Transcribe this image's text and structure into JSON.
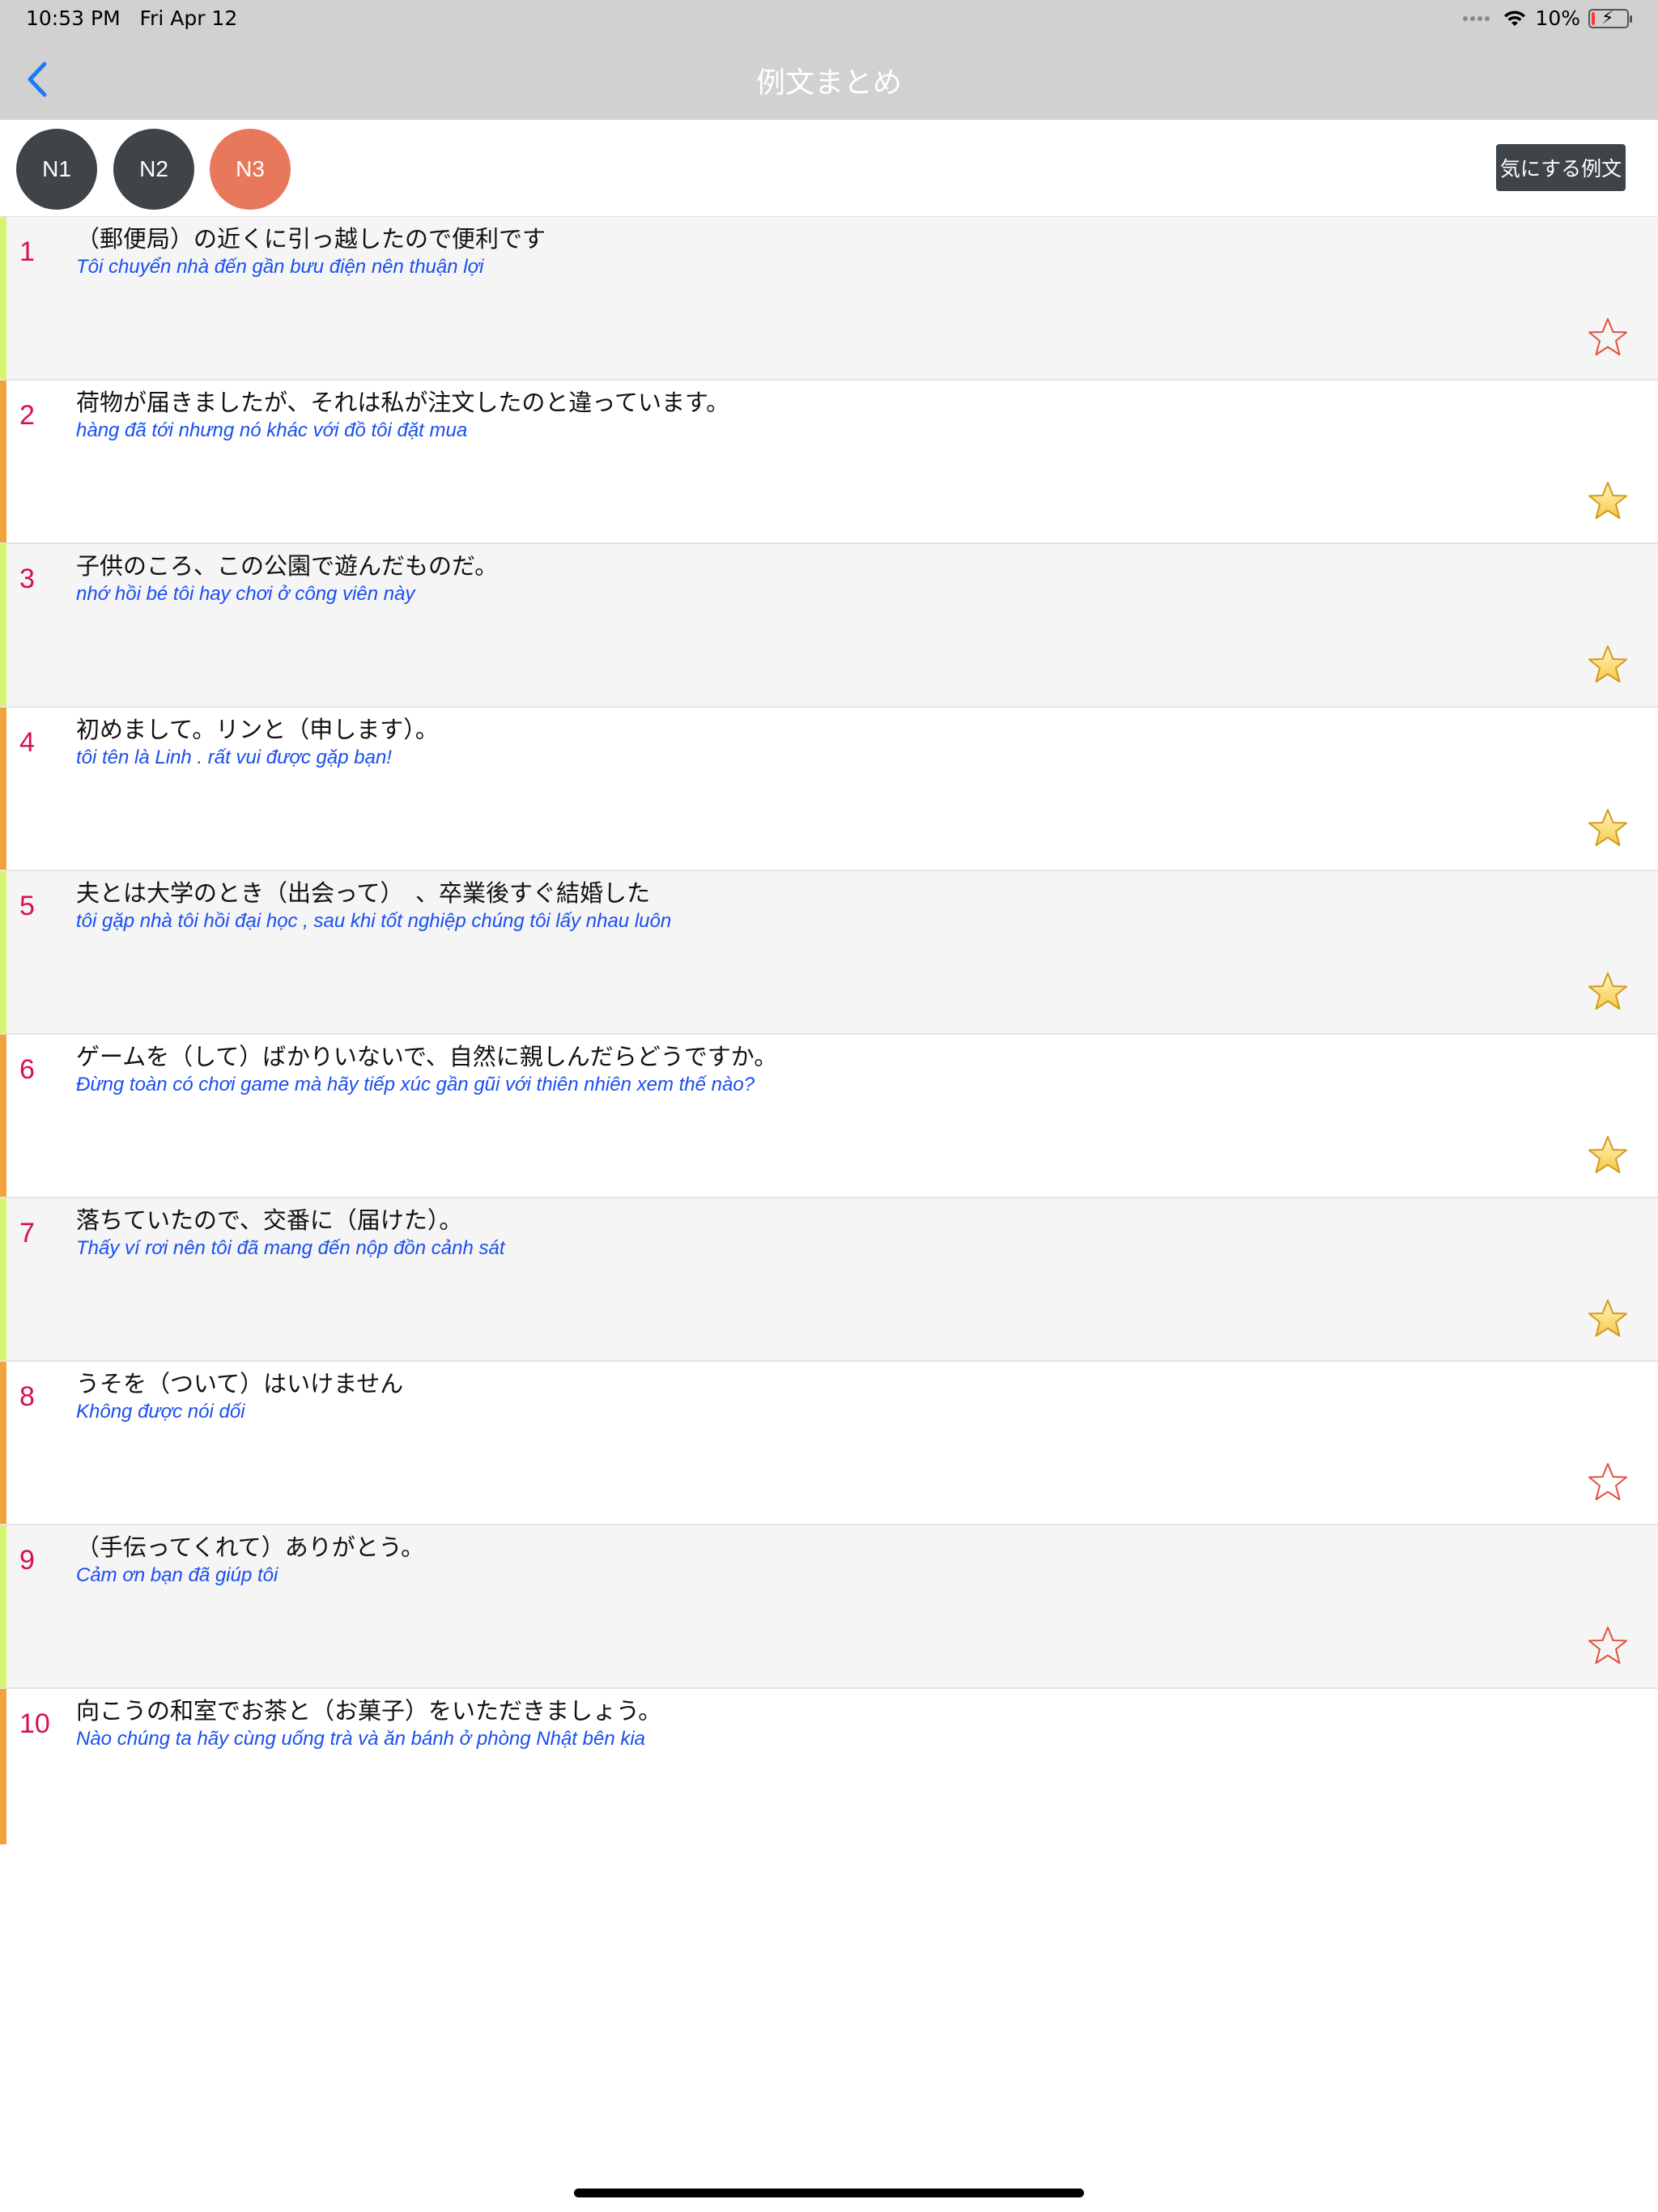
{
  "status_bar": {
    "time": "10:53 PM",
    "date": "Fri Apr 12",
    "battery": "10%",
    "battery_level": 0.1,
    "battery_color": "#ff3b30"
  },
  "nav": {
    "title": "例文まとめ",
    "back_icon": "chevron-left-icon",
    "accent": "#1a7cf5"
  },
  "levels": [
    {
      "label": "N1",
      "selected": false,
      "color": "#3f4449"
    },
    {
      "label": "N2",
      "selected": false,
      "color": "#3f4449"
    },
    {
      "label": "N3",
      "selected": true,
      "color": "#e8785c"
    }
  ],
  "favorites_filter_label": "気にする例文",
  "colors": {
    "stripe_light": "#d6f56e",
    "stripe_orange": "#f2a33c",
    "row_alt": "#f5f5f5",
    "number": "#d6114f",
    "translation": "#1a4ef0"
  },
  "sentences": [
    {
      "number": "1",
      "jp": "（郵便局）の近くに引っ越したので便利です",
      "vi": "Tôi chuyển nhà đến gần bưu điện nên thuận lợi",
      "favorite": false
    },
    {
      "number": "2",
      "jp": "荷物が届きましたが、それは私が注文したのと違っています。",
      "vi": "hàng đã tới nhưng nó khác với đồ tôi đặt mua",
      "favorite": true
    },
    {
      "number": "3",
      "jp": "子供のころ、この公園で遊んだものだ。",
      "vi": "nhớ hồi bé tôi hay chơi ở công viên này",
      "favorite": true
    },
    {
      "number": "4",
      "jp": "初めまして。リンと（申します）。",
      "vi": "tôi tên là Linh . rất vui được gặp bạn!",
      "favorite": true
    },
    {
      "number": "5",
      "jp": "夫とは大学のとき（出会って）　、卒業後すぐ結婚した",
      "vi": "tôi gặp nhà tôi hồi đại học , sau khi tốt nghiệp chúng tôi lấy nhau luôn",
      "favorite": true
    },
    {
      "number": "6",
      "jp": "ゲームを（して）ばかりいないで、自然に親しんだらどうですか。",
      "vi": "Đừng toàn có chơi game mà hãy tiếp xúc gần gũi với thiên nhiên xem thế nào?",
      "favorite": true
    },
    {
      "number": "7",
      "jp": " 落ちていたので、交番に（届けた）。",
      "vi": "Thấy ví rơi nên tôi đã mang đến nộp đồn cảnh sát",
      "favorite": true
    },
    {
      "number": "8",
      "jp": "うそを（ついて）はいけません",
      "vi": "Không được nói dối",
      "favorite": false
    },
    {
      "number": "9",
      "jp": "（手伝ってくれて）ありがとう。",
      "vi": "Cảm ơn bạn đã giúp tôi",
      "favorite": false
    },
    {
      "number": "10",
      "jp": "向こうの和室でお茶と（お菓子）をいただきましょう。",
      "vi": "Nào chúng ta hãy cùng uống trà và ăn bánh ở phòng Nhật bên kia",
      "favorite": null
    }
  ]
}
